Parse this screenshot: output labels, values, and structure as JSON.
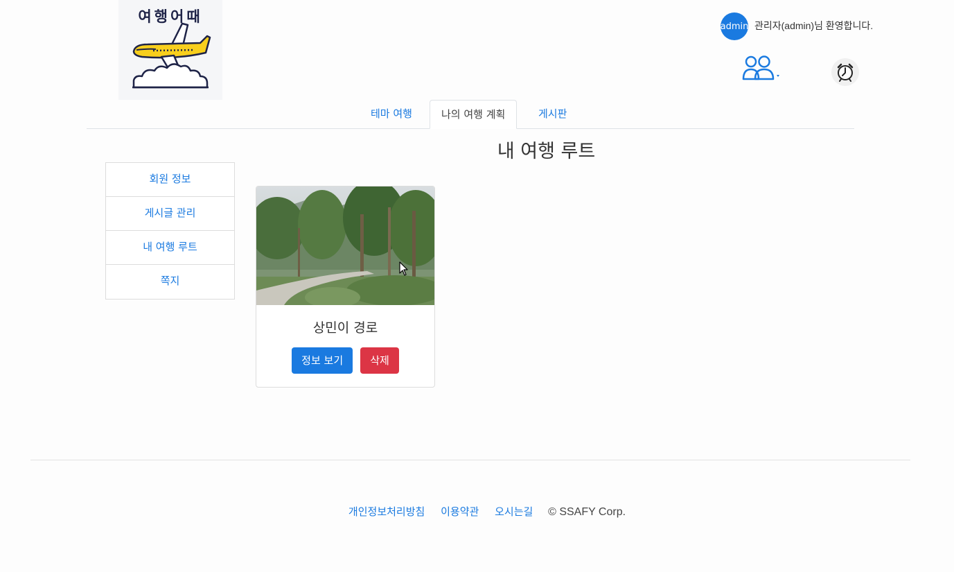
{
  "logo": {
    "text": "여행어때",
    "icon": "airplane-logo"
  },
  "header": {
    "avatar_text": "admin",
    "welcome": "관리자(admin)님 환영합니다.",
    "users_icon": "users-dropdown-icon",
    "clock_icon": "alarm-clock-icon"
  },
  "tabs": [
    {
      "label": "테마 여행",
      "active": false
    },
    {
      "label": "나의 여행 계획",
      "active": true
    },
    {
      "label": "게시판",
      "active": false
    }
  ],
  "page_title": "내 여행 루트",
  "sidebar": {
    "items": [
      {
        "label": "회원 정보"
      },
      {
        "label": "게시글 관리"
      },
      {
        "label": "내 여행 루트"
      },
      {
        "label": "쪽지"
      }
    ]
  },
  "cards": [
    {
      "title": "상민이 경로",
      "info_button": "정보 보기",
      "delete_button": "삭제"
    }
  ],
  "footer": {
    "links": [
      "개인정보처리방침",
      "이용약관",
      "오시는길"
    ],
    "copyright": "© SSAFY Corp."
  },
  "colors": {
    "primary": "#1a7ae0",
    "danger": "#dc3545"
  }
}
